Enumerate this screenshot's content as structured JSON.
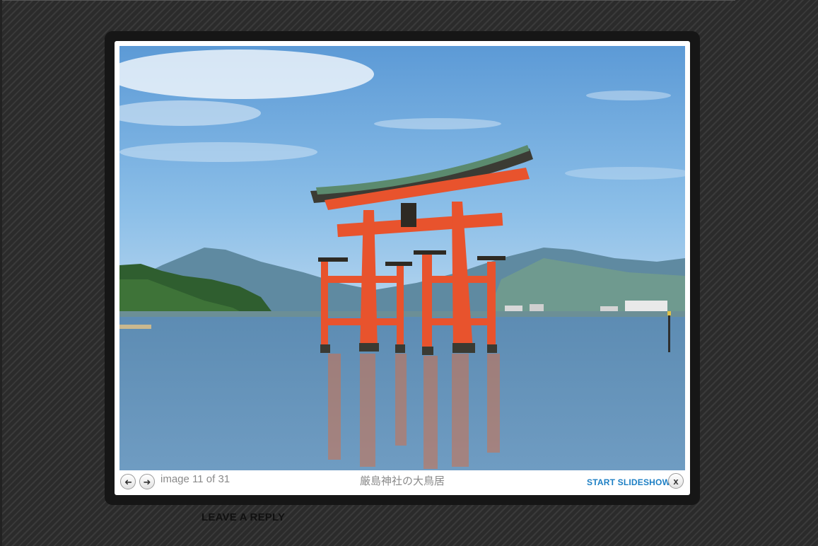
{
  "lightbox": {
    "image_alt": "厳島神社の大鳥居",
    "prev_icon": "arrow-left-icon",
    "next_icon": "arrow-right-icon",
    "prev_glyph": "➜",
    "next_glyph": "➜",
    "counter": "image 11 of 31",
    "caption": "厳島神社の大鳥居",
    "slideshow_label": "START SLIDESHOW",
    "close_icon": "close-icon",
    "close_glyph": "x"
  },
  "page": {
    "leave_reply": "LEAVE A REPLY"
  },
  "colors": {
    "link": "#1d7fc4",
    "frame": "#161616",
    "background": "#333333",
    "torii": "#e8532d"
  }
}
